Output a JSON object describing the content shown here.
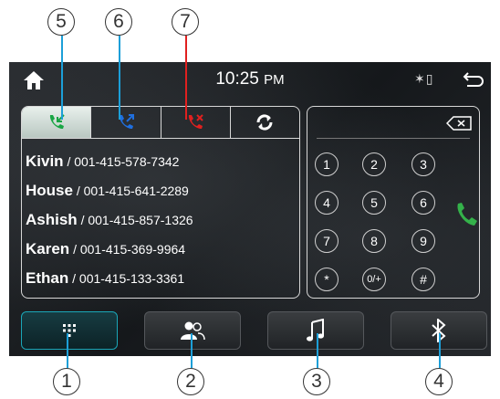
{
  "status": {
    "time": "10:25",
    "ampm": "PM",
    "indicators": "✶▯"
  },
  "tabs": [
    {
      "id": "received",
      "icon": "incoming-call-icon",
      "color": "#19a544",
      "active": true
    },
    {
      "id": "dialed",
      "icon": "outgoing-call-icon",
      "color": "#1f6fe0",
      "active": false
    },
    {
      "id": "missed",
      "icon": "missed-call-icon",
      "color": "#e0201f",
      "active": false
    },
    {
      "id": "sync",
      "icon": "sync-icon",
      "color": "#ffffff",
      "active": false
    }
  ],
  "contacts": [
    {
      "name": "Kivin",
      "sep": " / ",
      "number": "001-415-578-7342"
    },
    {
      "name": "House",
      "sep": " / ",
      "number": "001-415-641-2289"
    },
    {
      "name": "Ashish",
      "sep": " / ",
      "number": "001-415-857-1326"
    },
    {
      "name": "Karen",
      "sep": " / ",
      "number": "001-415-369-9964"
    },
    {
      "name": "Ethan",
      "sep": " / ",
      "number": "001-415-133-3361"
    }
  ],
  "keypad": [
    "1",
    "2",
    "3",
    "4",
    "5",
    "6",
    "7",
    "8",
    "9",
    "*",
    "0/+",
    "#"
  ],
  "bottom_bar": [
    {
      "id": "dialpad",
      "icon": "dialpad-icon",
      "active": true
    },
    {
      "id": "contacts",
      "icon": "contacts-icon",
      "active": false
    },
    {
      "id": "music",
      "icon": "music-note-icon",
      "active": false
    },
    {
      "id": "bluetooth",
      "icon": "bluetooth-icon",
      "active": false
    }
  ],
  "callouts": {
    "c1": "1",
    "c2": "2",
    "c3": "3",
    "c4": "4",
    "c5": "5",
    "c6": "6",
    "c7": "7"
  },
  "colors": {
    "accent": "#1aa7b8",
    "callout_line": "#1c9fd8",
    "missed": "#e0201f"
  }
}
